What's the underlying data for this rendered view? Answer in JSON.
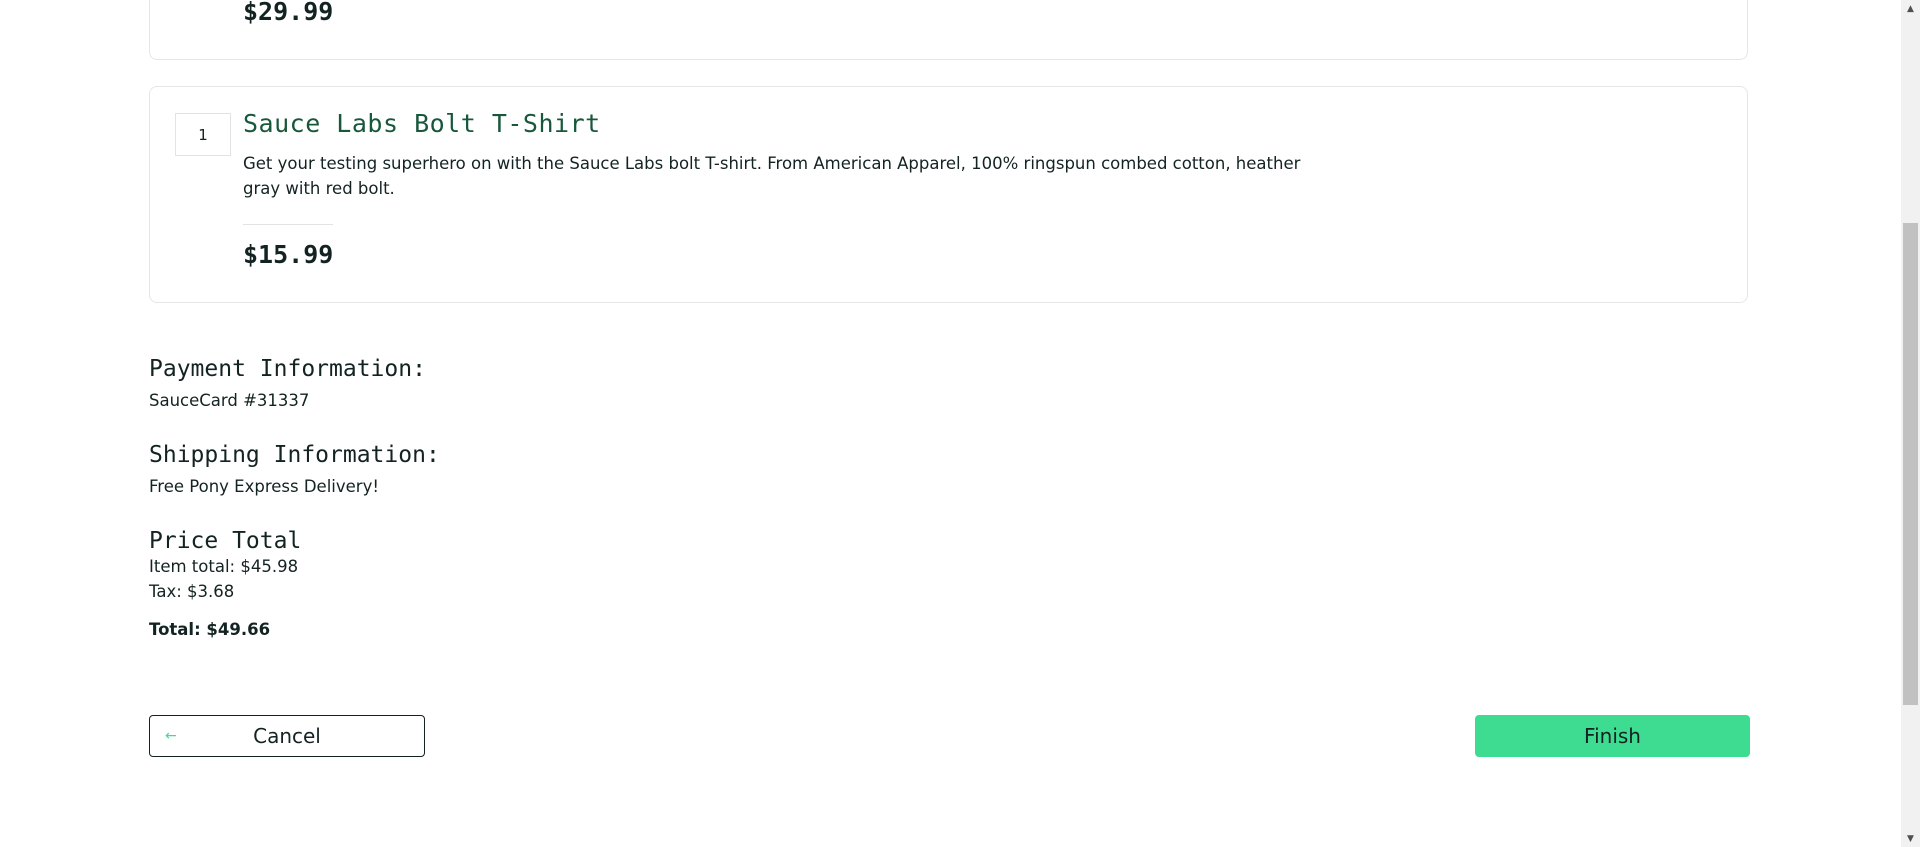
{
  "previous_item": {
    "price": "$29.99"
  },
  "cart_item": {
    "quantity": "1",
    "name": "Sauce Labs Bolt T-Shirt",
    "description": "Get your testing superhero on with the Sauce Labs bolt T-shirt. From American Apparel, 100% ringspun combed cotton, heather gray with red bolt.",
    "price": "$15.99"
  },
  "summary": {
    "payment_heading": "Payment Information:",
    "payment_value": "SauceCard #31337",
    "shipping_heading": "Shipping Information:",
    "shipping_value": "Free Pony Express Delivery!",
    "price_heading": "Price Total",
    "item_total": "Item total: $45.98",
    "tax": "Tax: $3.68",
    "total": "Total: $49.66"
  },
  "actions": {
    "cancel_label": "Cancel",
    "cancel_icon": "←",
    "finish_label": "Finish"
  },
  "colors": {
    "accent": "#3ddc91",
    "title_green": "#18583a",
    "text": "#132322"
  },
  "scrollbar": {
    "up_icon": "▲",
    "down_icon": "▼"
  }
}
